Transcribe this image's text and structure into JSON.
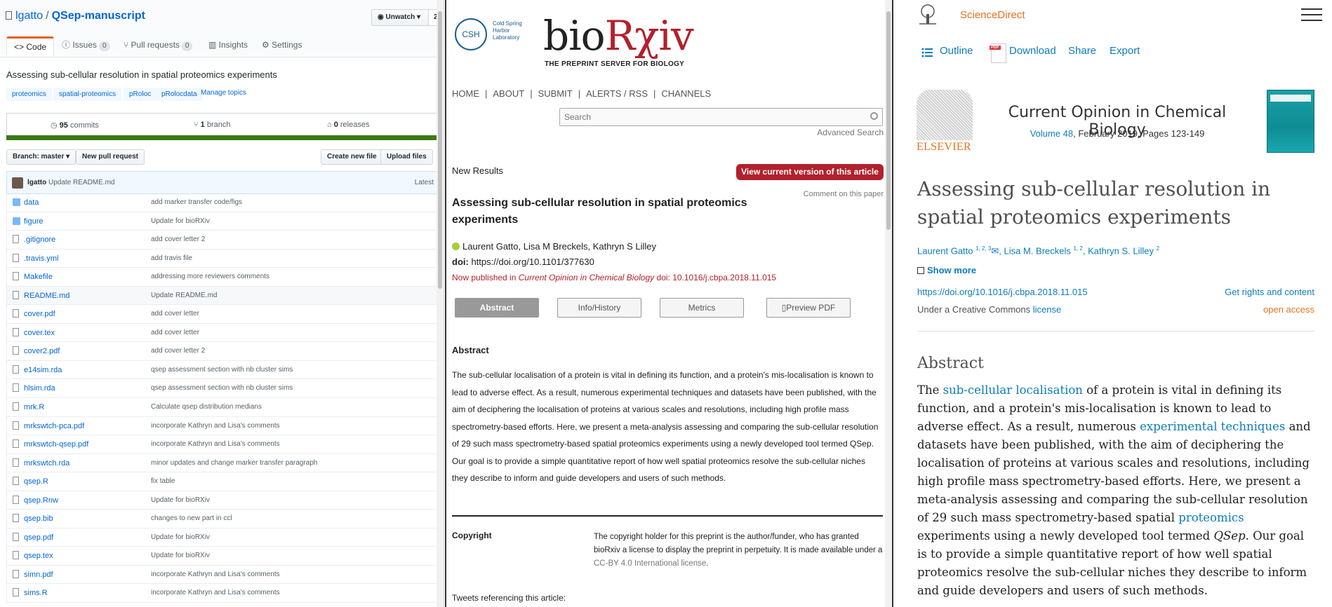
{
  "github": {
    "owner": "lgatto",
    "repo": "QSep-manuscript",
    "unwatch_label": "Unwatch",
    "watch_count": "2",
    "tabs": [
      {
        "label": "Code"
      },
      {
        "label": "Issues",
        "count": "0"
      },
      {
        "label": "Pull requests",
        "count": "0"
      },
      {
        "label": "Insights"
      },
      {
        "label": "Settings"
      }
    ],
    "description": "Assessing sub-cellular resolution in spatial proteomics experiments",
    "topics": [
      "proteomics",
      "spatial-proteomics",
      "pRoloc",
      "pRolocdata"
    ],
    "manage_topics": "Manage topics",
    "commits_count": "95",
    "commits_label": "commits",
    "branch_count": "1",
    "branch_label": "branch",
    "releases_count": "0",
    "releases_label": "releases",
    "branch_button": "Branch: master ▾",
    "new_pr_button": "New pull request",
    "create_file_button": "Create new file",
    "upload_button": "Upload files",
    "last_commit_author": "lgatto",
    "last_commit_message": "Update README.md",
    "latest_label": "Latest",
    "files": [
      {
        "name": "data",
        "type": "dir",
        "message": "add marker transfer code/figs"
      },
      {
        "name": "figure",
        "type": "dir",
        "message": "Update for bioRXiv"
      },
      {
        "name": ".gitignore",
        "type": "file",
        "message": "add cover letter 2"
      },
      {
        "name": ".travis.yml",
        "type": "file",
        "message": "add travis file"
      },
      {
        "name": "Makefile",
        "type": "file",
        "message": "addressing more reviewers comments"
      },
      {
        "name": "README.md",
        "type": "file",
        "message": "Update README.md"
      },
      {
        "name": "cover.pdf",
        "type": "file",
        "message": "add cover letter"
      },
      {
        "name": "cover.tex",
        "type": "file",
        "message": "add cover letter"
      },
      {
        "name": "cover2.pdf",
        "type": "file",
        "message": "add cover letter 2"
      },
      {
        "name": "e14sim.rda",
        "type": "file",
        "message": "qsep assessment section with nb cluster sims"
      },
      {
        "name": "hlsim.rda",
        "type": "file",
        "message": "qsep assessment section with nb cluster sims"
      },
      {
        "name": "mrk.R",
        "type": "file",
        "message": "Calculate qsep distribution medians"
      },
      {
        "name": "mrkswtch-pca.pdf",
        "type": "file",
        "message": "incorporate Kathryn and Lisa's comments"
      },
      {
        "name": "mrkswtch-qsep.pdf",
        "type": "file",
        "message": "incorporate Kathryn and Lisa's comments"
      },
      {
        "name": "mrkswtch.rda",
        "type": "file",
        "message": "minor updates and change marker transfer paragraph"
      },
      {
        "name": "qsep.R",
        "type": "file",
        "message": "fix table"
      },
      {
        "name": "qsep.Rnw",
        "type": "file",
        "message": "Update for bioRXiv"
      },
      {
        "name": "qsep.bib",
        "type": "file",
        "message": "changes to new part in ccl"
      },
      {
        "name": "qsep.pdf",
        "type": "file",
        "message": "Update for bioRXiv"
      },
      {
        "name": "qsep.tex",
        "type": "file",
        "message": "Update for bioRXiv"
      },
      {
        "name": "simn.pdf",
        "type": "file",
        "message": "incorporate Kathryn and Lisa's comments"
      },
      {
        "name": "sims.R",
        "type": "file",
        "message": "incorporate Kathryn and Lisa's comments"
      }
    ]
  },
  "biorxiv": {
    "cshl_badge": "CSH",
    "cshl_text": "Cold Spring Harbor Laboratory",
    "logo_main": "bio",
    "logo_accent": "Rχiv",
    "tagline": "THE PREPRINT SERVER FOR BIOLOGY",
    "nav": [
      "HOME",
      "ABOUT",
      "SUBMIT",
      "ALERTS / RSS",
      "CHANNELS"
    ],
    "search_placeholder": "Search",
    "advanced_search": "Advanced Search",
    "section_label": "New Results",
    "view_current_button": "View current version of this article",
    "comment_link": "Comment on this paper",
    "title": "Assessing sub-cellular resolution in spatial proteomics experiments",
    "authors": "Laurent Gatto, Lisa M Breckels, Kathryn S Lilley",
    "doi_label": "doi:",
    "doi_value": "https://doi.org/10.1101/377630",
    "published_prefix": "Now published in",
    "published_journal": "Current Opinion in Chemical Biology",
    "published_doi": "doi: 10.1016/j.cbpa.2018.11.015",
    "tabs": [
      "Abstract",
      "Info/History",
      "Metrics",
      "Preview PDF"
    ],
    "abstract_heading": "Abstract",
    "abstract": "The sub-cellular localisation of a protein is vital in defining its function, and a protein's mis-localisation is known to lead to adverse effect. As a result, numerous experimental techniques and datasets have been published, with the aim of deciphering the localisation of proteins at various scales and resolutions, including high profile mass spectrometry-based efforts. Here, we present a meta-analysis assessing and comparing the sub-cellular resolution of 29 such mass spectrometry-based spatial proteomics experiments using a newly developed tool termed QSep. Our goal is to provide a simple quantitative report of how well spatial proteomics resolve the sub-cellular niches they describe to inform and guide developers and users of such methods.",
    "copyright_heading": "Copyright",
    "copyright_text": "The copyright holder for this preprint is the author/funder, who has granted bioRxiv a license to display the preprint in perpetuity. It is made available under a",
    "copyright_license": "CC-BY 4.0 International license",
    "tweets_label": "Tweets referencing this article:"
  },
  "sciencedirect": {
    "brand": "ScienceDirect",
    "toolbar": [
      "Outline",
      "Download",
      "Share",
      "Export"
    ],
    "publisher": "ELSEVIER",
    "journal": "Current Opinion in Chemical Biology",
    "volume_link": "Volume 48",
    "volume_rest": ", February 2019, Pages 123-149",
    "title": "Assessing sub-cellular resolution in spatial proteomics experiments",
    "authors": [
      {
        "name": "Laurent Gatto",
        "sup": "1, 2, 3"
      },
      {
        "name": "Lisa M. Breckels",
        "sup": "1, 2"
      },
      {
        "name": "Kathryn S. Lilley",
        "sup": "2"
      }
    ],
    "show_more": "Show more",
    "doi": "https://doi.org/10.1016/j.cbpa.2018.11.015",
    "rights": "Get rights and content",
    "cc_prefix": "Under a Creative Commons",
    "cc_link": "license",
    "open_access": "open access",
    "abstract_heading": "Abstract",
    "abstract_parts": [
      {
        "t": "The ",
        "link": false
      },
      {
        "t": "sub-cellular localisation",
        "link": true
      },
      {
        "t": " of a protein is vital in defining its function, and a protein's mis-localisation is known to lead to adverse effect. As a result, numerous ",
        "link": false
      },
      {
        "t": "experimental techniques",
        "link": true
      },
      {
        "t": " and datasets have been published, with the aim of deciphering the localisation of proteins at various scales and resolutions, including high profile mass spectrometry-based efforts. Here, we present a meta-analysis assessing and comparing the sub-cellular resolution of 29 such mass spectrometry-based spatial ",
        "link": false
      },
      {
        "t": "proteomics",
        "link": true
      },
      {
        "t": " experiments using a newly developed tool termed ",
        "link": false
      },
      {
        "t": "QSep",
        "link": false,
        "italic": true
      },
      {
        "t": ". Our goal is to provide a simple quantitative report of how well spatial proteomics resolve the sub-cellular niches they describe to inform and guide developers and users of such methods.",
        "link": false
      }
    ]
  }
}
